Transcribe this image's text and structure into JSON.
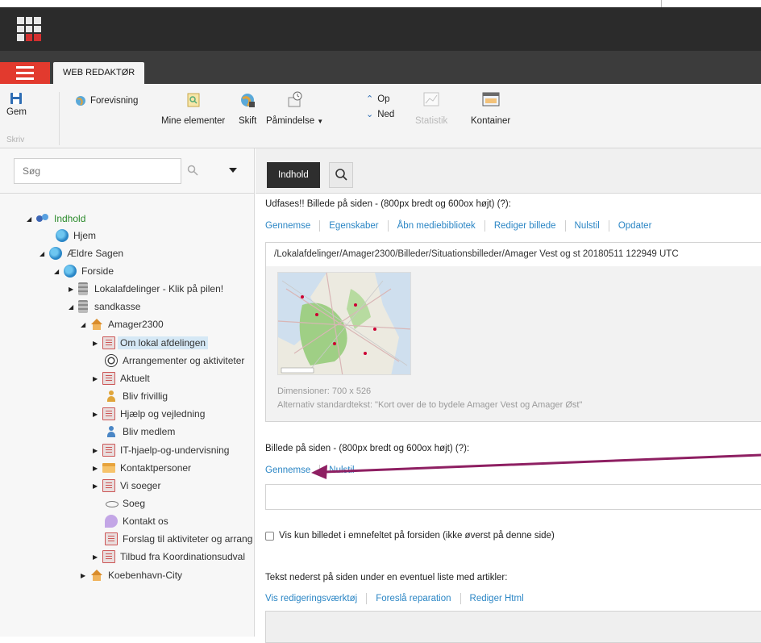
{
  "app": {
    "tab_label": "WEB REDAKTØR"
  },
  "ribbon": {
    "save_label": "Gem",
    "write_label": "Skriv",
    "preview_label": "Forevisning",
    "my_items_label": "Mine elementer",
    "switch_label": "Skift",
    "reminder_label": "Påmindelse",
    "up_label": "Op",
    "down_label": "Ned",
    "statistics_label": "Statistik",
    "container_label": "Kontainer"
  },
  "sidebar": {
    "search_placeholder": "Søg",
    "tree": [
      {
        "label": "Indhold",
        "icon": "people-icon"
      },
      {
        "label": "Hjem",
        "icon": "globe-icon"
      },
      {
        "label": "Ældre Sagen",
        "icon": "globe-icon"
      },
      {
        "label": "Forside",
        "icon": "globe-icon"
      },
      {
        "label": "Lokalafdelinger - Klik på pilen!",
        "icon": "database-icon"
      },
      {
        "label": "sandkasse",
        "icon": "database-icon"
      },
      {
        "label": "Amager2300",
        "icon": "home-icon"
      },
      {
        "label": "Om lokal afdelingen",
        "icon": "document-icon"
      },
      {
        "label": "Arrangementer og aktiviteter",
        "icon": "football-icon"
      },
      {
        "label": "Aktuelt",
        "icon": "document-icon"
      },
      {
        "label": "Bliv frivillig",
        "icon": "person-icon"
      },
      {
        "label": "Hjælp og vejledning",
        "icon": "document-icon"
      },
      {
        "label": "Bliv medlem",
        "icon": "person-icon"
      },
      {
        "label": "IT-hjaelp-og-undervisning",
        "icon": "document-icon"
      },
      {
        "label": "Kontaktpersoner",
        "icon": "folder-icon"
      },
      {
        "label": "Vi soeger",
        "icon": "document-icon"
      },
      {
        "label": "Soeg",
        "icon": "eye-icon"
      },
      {
        "label": "Kontakt os",
        "icon": "speech-bubble-icon"
      },
      {
        "label": "Forslag til aktiviteter og arrang",
        "icon": "document-icon"
      },
      {
        "label": "Tilbud fra Koordinationsudval",
        "icon": "document-icon"
      },
      {
        "label": "Koebenhavn-City",
        "icon": "home-icon"
      }
    ]
  },
  "main": {
    "tab_content": "Indhold",
    "field1": {
      "title": "Udfases!! Billede på siden - (800px bredt og 600ox højt) (?):",
      "links": [
        "Gennemse",
        "Egenskaber",
        "Åbn mediebibliotek",
        "Rediger billede",
        "Nulstil",
        "Opdater"
      ],
      "path": "/Lokalafdelinger/Amager2300/Billeder/Situationsbilleder/Amager Vest og st 20180511 122949 UTC",
      "dimensions": "Dimensioner: 700 x 526",
      "alt_text": "Alternativ standardtekst: \"Kort over de to bydele Amager Vest og Amager Øst\""
    },
    "field2": {
      "title": "Billede på siden - (800px bredt og 600ox højt) (?):",
      "browse": "Gennemse",
      "reset": "Nulstil"
    },
    "checkbox_label": "Vis kun billedet i emnefeltet på forsiden (ikke øverst på denne side)",
    "field3": {
      "title": "Tekst nederst på siden under en eventuel liste med artikler:",
      "links": [
        "Vis redigeringsværktøj",
        "Foreslå reparation",
        "Rediger Html"
      ]
    }
  },
  "colors": {
    "accent_red": "#e23a2e",
    "link_blue": "#2b86c5",
    "annotation_arrow": "#8e1f62",
    "selection": "#d5e8f5"
  }
}
